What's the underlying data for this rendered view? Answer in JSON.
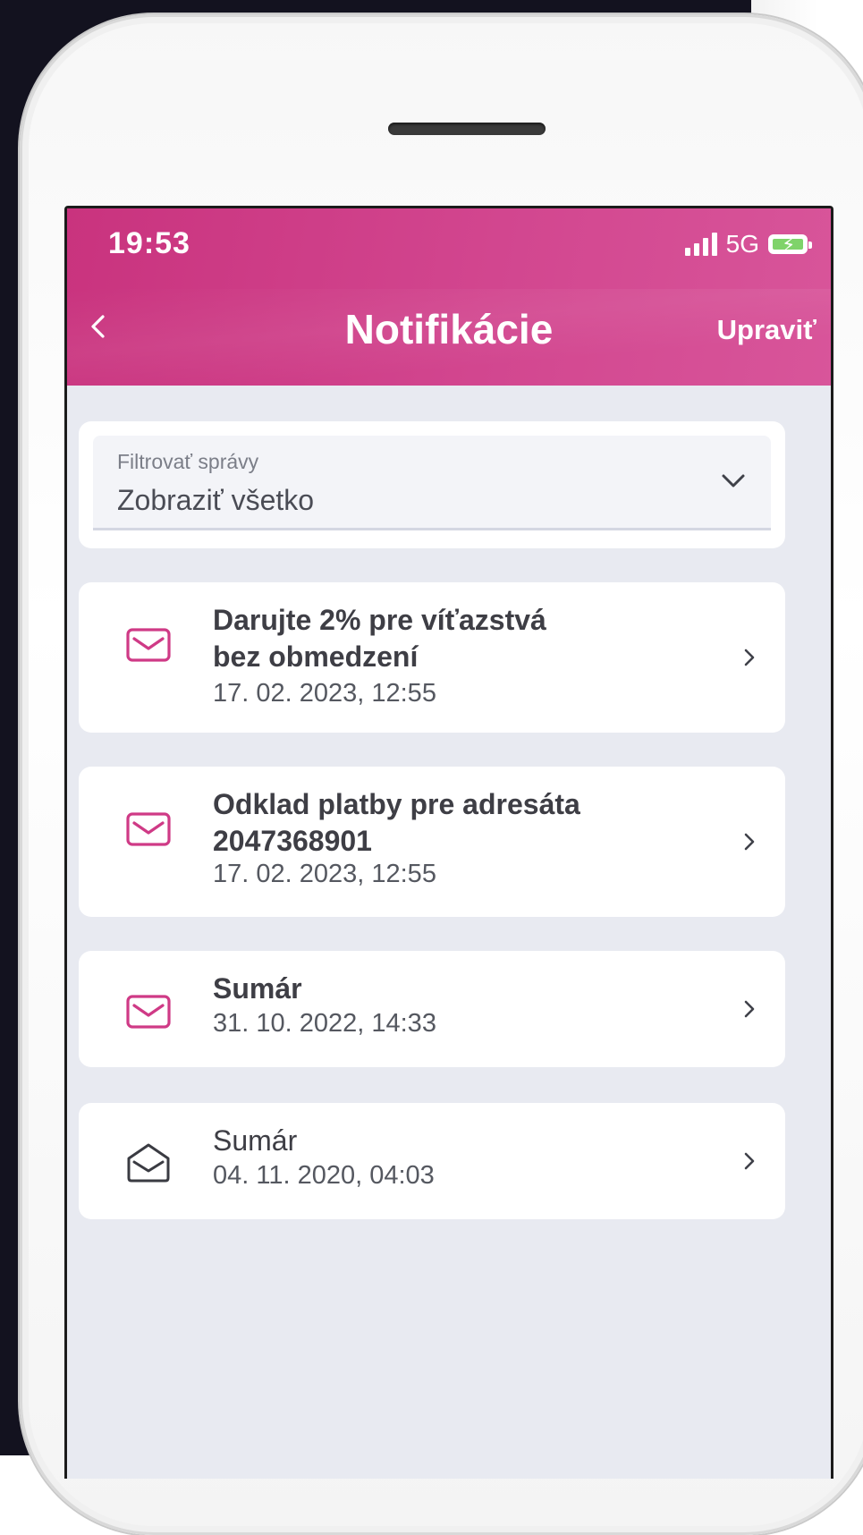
{
  "status_bar": {
    "time": "19:53",
    "network": "5G"
  },
  "header": {
    "title": "Notifikácie",
    "edit_label": "Upraviť"
  },
  "filter": {
    "label": "Filtrovať správy",
    "value": "Zobraziť všetko"
  },
  "notifications": [
    {
      "title_line1": "Darujte 2% pre víťazstvá",
      "title_line2": "bez obmedzení",
      "date": "17. 02. 2023, 12:55",
      "unread": true,
      "icon": "envelope-closed-icon"
    },
    {
      "title_line1": "Odklad platby pre adresáta",
      "title_line2": "2047368901",
      "date": "17. 02. 2023, 12:55",
      "unread": true,
      "icon": "envelope-closed-icon"
    },
    {
      "title_line1": "Sumár",
      "date": "31. 10. 2022, 14:33",
      "unread": true,
      "icon": "envelope-closed-icon"
    },
    {
      "title_line1": "Sumár",
      "date": "04. 11. 2020, 04:03",
      "unread": false,
      "icon": "envelope-open-icon"
    }
  ],
  "colors": {
    "brand": "#d2468f",
    "accent_icon": "#cf3a86",
    "background": "#e8eaf1"
  }
}
